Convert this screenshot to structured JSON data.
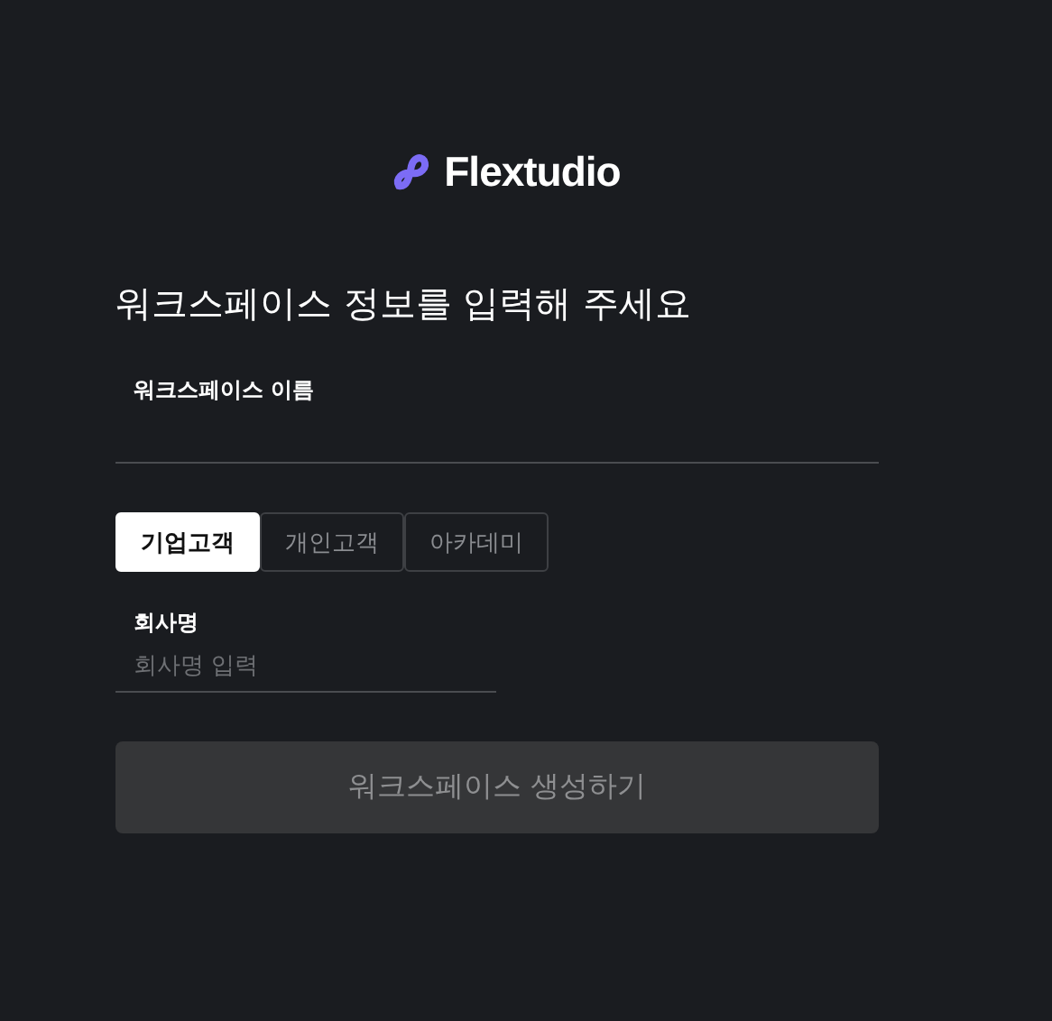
{
  "logo": {
    "text": "Flextudio"
  },
  "heading": "워크스페이스 정보를 입력해 주세요",
  "workspace_name": {
    "label": "워크스페이스 이름"
  },
  "customer_types": [
    {
      "label": "기업고객",
      "selected": true
    },
    {
      "label": "개인고객",
      "selected": false
    },
    {
      "label": "아카데미",
      "selected": false
    }
  ],
  "company_name": {
    "label": "회사명",
    "placeholder": "회사명 입력"
  },
  "submit": {
    "label": "워크스페이스 생성하기",
    "disabled": true
  }
}
